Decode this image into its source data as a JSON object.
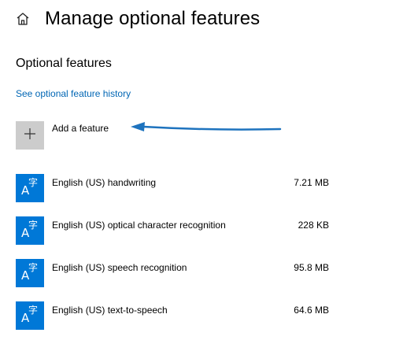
{
  "header": {
    "home_icon": "home-icon",
    "title": "Manage optional features"
  },
  "section": {
    "title": "Optional features",
    "history_link": "See optional feature history"
  },
  "add_feature": {
    "icon": "plus-icon",
    "label": "Add a feature"
  },
  "features": [
    {
      "name": "English (US) handwriting",
      "size": "7.21 MB",
      "icon": "language-icon"
    },
    {
      "name": "English (US) optical character recognition",
      "size": "228 KB",
      "icon": "language-icon"
    },
    {
      "name": "English (US) speech recognition",
      "size": "95.8 MB",
      "icon": "language-icon"
    },
    {
      "name": "English (US) text-to-speech",
      "size": "64.6 MB",
      "icon": "language-icon"
    }
  ],
  "colors": {
    "accent": "#0078d7",
    "link": "#0066b4",
    "annotation_arrow": "#1e73be",
    "add_tile": "#cccccc"
  }
}
